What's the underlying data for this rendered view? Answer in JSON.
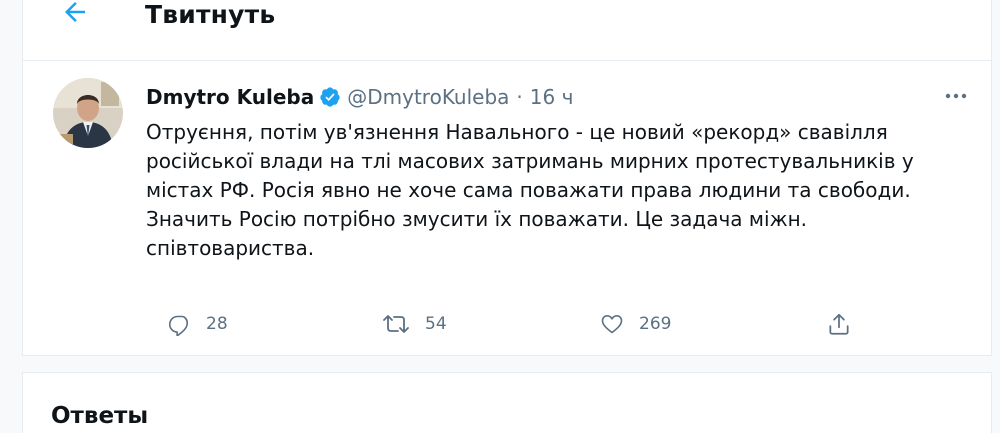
{
  "header": {
    "title": "Твитнуть",
    "back_icon": "arrow-left-icon"
  },
  "tweet": {
    "author_name": "Dmytro Kuleba",
    "verified_icon": "verified-badge-icon",
    "handle": "@DmytroKuleba",
    "separator": "·",
    "timestamp": "16 ч",
    "more_icon": "more-horizontal-icon",
    "text_lines": [
      "Отруєння, потім ув'язнення Навального - це новий «рекорд» свавілля",
      "російської влади на тлі масових затримань мирних протестувальників у",
      "містах РФ. Росія явно не хоче сама поважати права людини та свободи.",
      "Значить Росію потрібно змусити їх поважати. Це задача міжн.",
      "співтовариства."
    ],
    "actions": {
      "reply": {
        "icon": "reply-icon",
        "count": "28"
      },
      "retweet": {
        "icon": "retweet-icon",
        "count": "54"
      },
      "like": {
        "icon": "heart-icon",
        "count": "269"
      },
      "share": {
        "icon": "share-icon"
      }
    }
  },
  "replies": {
    "title": "Ответы"
  },
  "colors": {
    "accent": "#1da1f2",
    "text": "#0f1419",
    "secondary": "#5b7083",
    "border": "#e6ecf0",
    "background": "#f7f9fa"
  }
}
